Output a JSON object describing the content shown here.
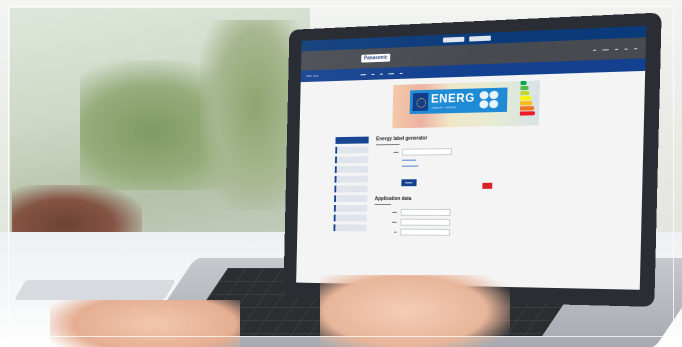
{
  "site": {
    "brand": "Panasonic",
    "header_links": [
      "",
      "",
      "",
      "",
      ""
    ],
    "nav_sub": "PRO Club",
    "nav_items": [
      "",
      "",
      "",
      "",
      ""
    ],
    "top_buttons": [
      "",
      ""
    ]
  },
  "banner": {
    "word": "ENERG",
    "tagline": "енергия · ενέργεια",
    "scale_colors": [
      "#00a651",
      "#4cb848",
      "#bfd730",
      "#fff200",
      "#fdb913",
      "#f37021",
      "#ed1c24"
    ]
  },
  "form": {
    "title": "Energy label generator",
    "intro": "",
    "section2": "Application data",
    "red_button_label": "",
    "submit_label": ""
  },
  "sidebar": {
    "items": [
      "",
      "",
      "",
      "",
      "",
      "",
      "",
      "",
      "",
      ""
    ]
  }
}
